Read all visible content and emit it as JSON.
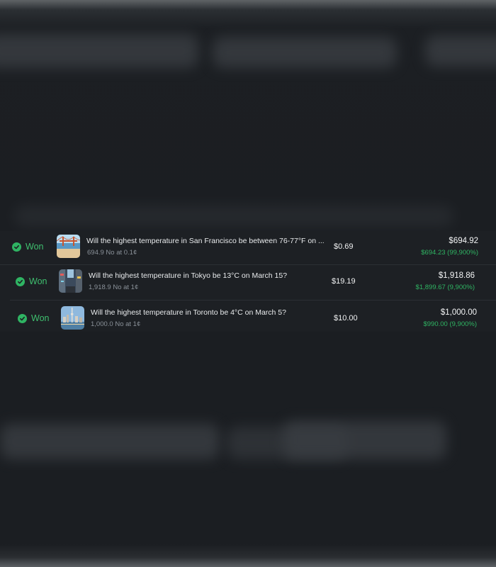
{
  "positions": [
    {
      "status": "Won",
      "image": "golden-gate-bridge-photo",
      "title": "Will the highest temperature in San Francisco be between 76-77°F on ...",
      "shares": "694.9 No at 0.1¢",
      "bet": "$0.69",
      "value": "$694.92",
      "gain": "$694.23 (99,900%)"
    },
    {
      "status": "Won",
      "image": "tokyo-street-photo",
      "title": "Will the highest temperature in Tokyo be 13°C on March 15?",
      "shares": "1,918.9 No at 1¢",
      "bet": "$19.19",
      "value": "$1,918.86",
      "gain": "$1,899.67 (9,900%)"
    },
    {
      "status": "Won",
      "image": "toronto-skyline-photo",
      "title": "Will the highest temperature in Toronto be 4°C on March 5?",
      "shares": "1,000.0 No at 1¢",
      "bet": "$10.00",
      "value": "$1,000.00",
      "gain": "$990.00 (9,900%)"
    }
  ],
  "colors": {
    "won": "#2fb463",
    "background": "#1d2024",
    "text": "#e8eaec",
    "muted": "#8a9199"
  }
}
